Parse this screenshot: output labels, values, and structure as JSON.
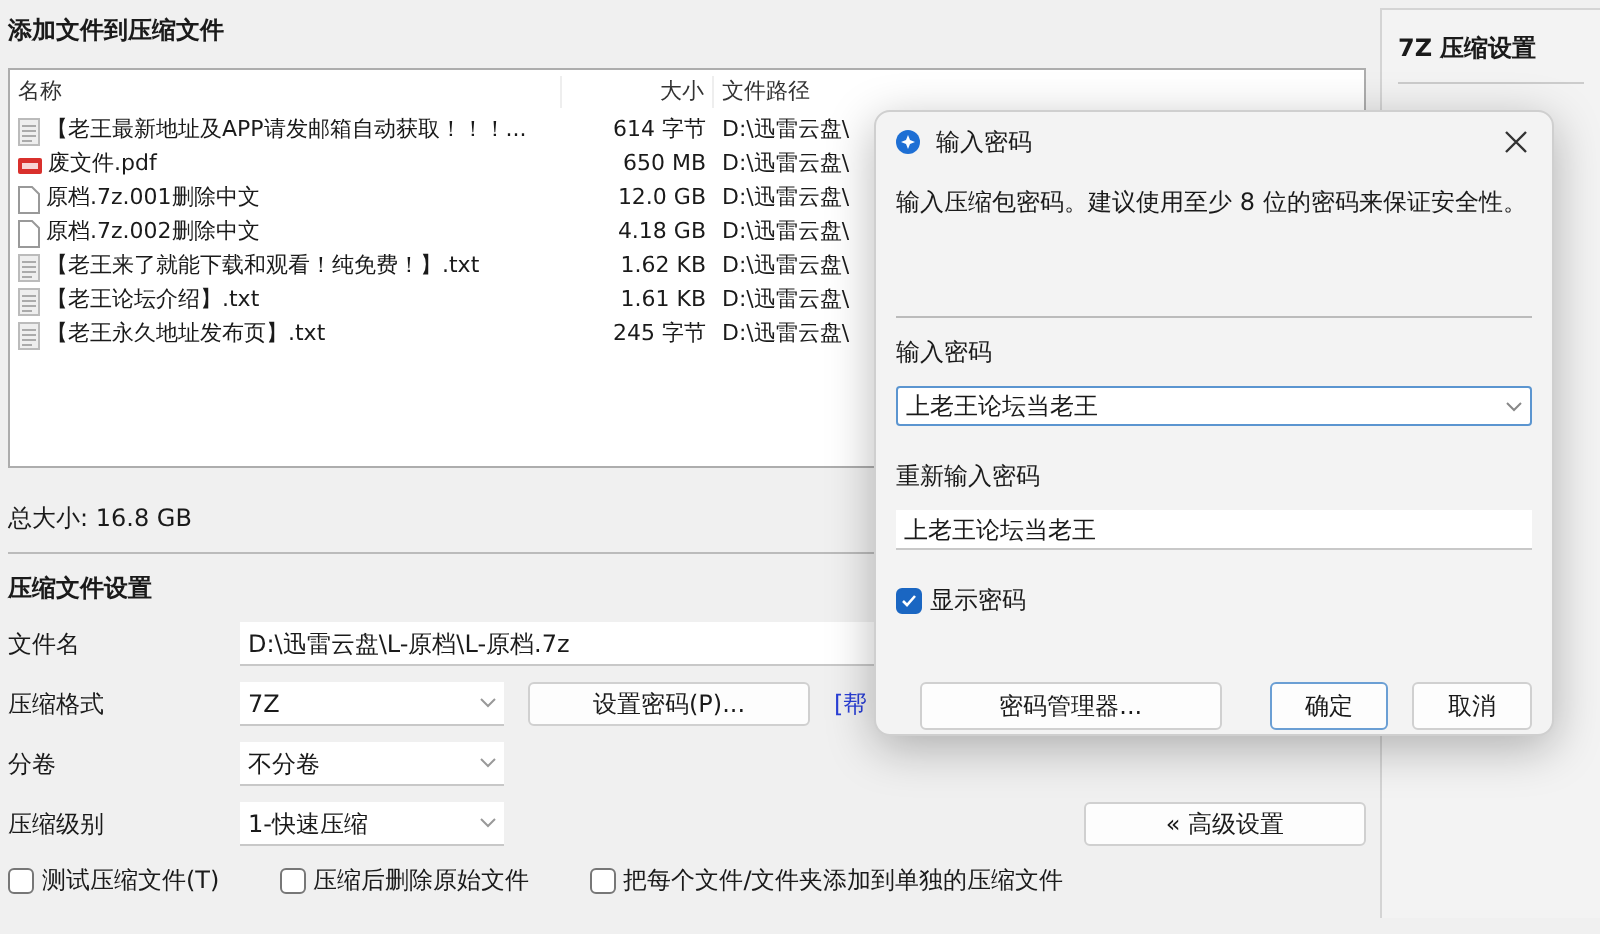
{
  "window": {
    "title": "添加文件到压缩文件"
  },
  "file_list": {
    "columns": [
      "名称",
      "大小",
      "文件路径"
    ],
    "rows": [
      {
        "kind": "text",
        "name": "【老王最新地址及APP请发邮箱自动获取！！！...",
        "size": "614 字节",
        "path": "D:\\迅雷云盘\\"
      },
      {
        "kind": "pdf",
        "name": "废文件.pdf",
        "size": "650 MB",
        "path": "D:\\迅雷云盘\\"
      },
      {
        "kind": "blank",
        "name": "原档.7z.001删除中文",
        "size": "12.0 GB",
        "path": "D:\\迅雷云盘\\"
      },
      {
        "kind": "blank",
        "name": "原档.7z.002删除中文",
        "size": "4.18 GB",
        "path": "D:\\迅雷云盘\\"
      },
      {
        "kind": "text",
        "name": "【老王来了就能下载和观看！纯免费！】.txt",
        "size": "1.62 KB",
        "path": "D:\\迅雷云盘\\"
      },
      {
        "kind": "text",
        "name": "【老王论坛介绍】.txt",
        "size": "1.61 KB",
        "path": "D:\\迅雷云盘\\"
      },
      {
        "kind": "text",
        "name": "【老王永久地址发布页】.txt",
        "size": "245 字节",
        "path": "D:\\迅雷云盘\\"
      }
    ]
  },
  "total_size": "总大小: 16.8 GB",
  "settings": {
    "title": "压缩文件设置",
    "filename_label": "文件名",
    "filename": "D:\\迅雷云盘\\L-原档\\L-原档.7z",
    "format_label": "压缩格式",
    "format": "7Z",
    "set_password_button": "设置密码(P)...",
    "help_link": "[帮",
    "volume_label": "分卷",
    "volume": "不分卷",
    "level_label": "压缩级别",
    "level_value": "1-快速压缩",
    "advanced_button": "« 高级设置",
    "options": [
      {
        "label": "测试压缩文件(T)",
        "checked": false
      },
      {
        "label": "压缩后删除原始文件",
        "checked": false
      },
      {
        "label": "把每个文件/文件夹添加到单独的压缩文件",
        "checked": false
      }
    ]
  },
  "side_panel": {
    "title": "7Z 压缩设置"
  },
  "dialog": {
    "title": "输入密码",
    "message": "输入压缩包密码。建议使用至少 8 位的密码来保证安全性。",
    "password_label": "输入密码",
    "password": "上老王论坛当老王",
    "confirm_label": "重新输入密码",
    "confirm": "上老王论坛当老王",
    "show_password": {
      "label": "显示密码",
      "checked": true
    },
    "buttons": [
      {
        "label": "密码管理器...",
        "default": false
      },
      {
        "label": "确定",
        "default": true
      },
      {
        "label": "取消",
        "default": false
      }
    ]
  }
}
